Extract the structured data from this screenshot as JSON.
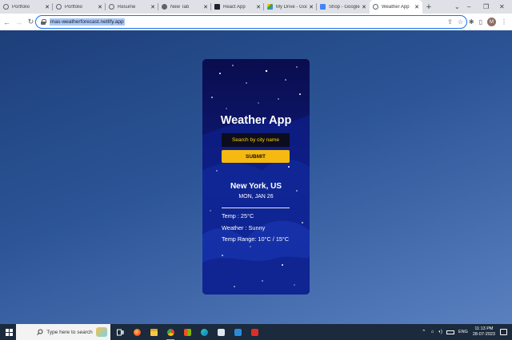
{
  "browser": {
    "tabs": [
      {
        "title": "Portfolio",
        "favicon_color": "#5f6368",
        "active": false
      },
      {
        "title": "Portfolio",
        "favicon_color": "#5f6368",
        "active": false
      },
      {
        "title": "Resume",
        "favicon_color": "#5f6368",
        "active": false
      },
      {
        "title": "New Tab",
        "favicon_color": "#5f6368",
        "active": false
      },
      {
        "title": "React App",
        "favicon_color": "#20232a",
        "active": false
      },
      {
        "title": "My Drive - Goog",
        "favicon_color": "#34a853",
        "active": false
      },
      {
        "title": "Shop - Google D",
        "favicon_color": "#4285f4",
        "active": false
      },
      {
        "title": "Weather App",
        "favicon_color": "#5f6368",
        "active": true
      }
    ],
    "new_tab_icon": "+",
    "url": "mas-weatherforecast.netlify.app"
  },
  "app": {
    "title": "Weather App",
    "search_placeholder": "Search by city name",
    "submit_label": "SUBMIT",
    "city": "New York, US",
    "date": "MON, JAN 26",
    "temp": "Temp : 25°C",
    "weather": "Weather : Sunny",
    "range": "Temp Range: 10°C / 15°C"
  },
  "taskbar": {
    "search_placeholder": "Type here to search",
    "lang": "ENG",
    "time": "11:13 PM",
    "date": "28-07-2023"
  },
  "colors": {
    "accent": "#f5b912",
    "card_bg": "#0a0f56",
    "search_text": "#ffd600"
  }
}
